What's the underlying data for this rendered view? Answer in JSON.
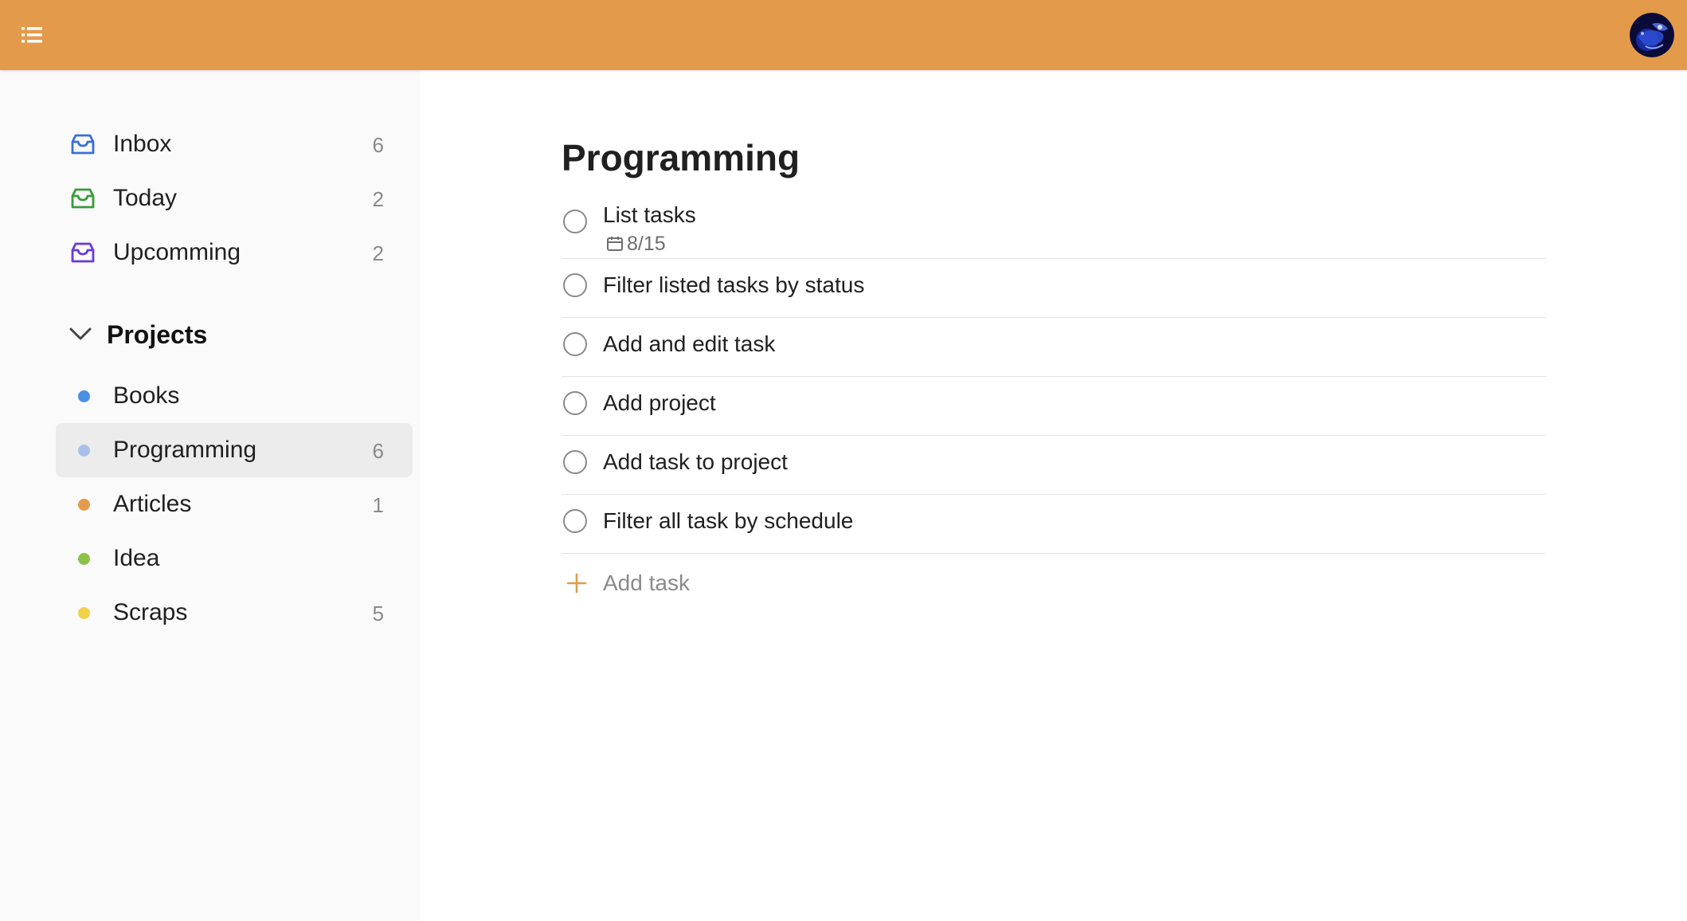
{
  "header": {
    "menu_icon": "list-menu-icon",
    "avatar_icon": "user-avatar",
    "bar_color": "#e39b4b"
  },
  "sidebar": {
    "filters": [
      {
        "label": "Inbox",
        "count": "6",
        "icon": "inbox-icon",
        "color": "#3a6fd8"
      },
      {
        "label": "Today",
        "count": "2",
        "icon": "inbox-icon",
        "color": "#3a9b3a"
      },
      {
        "label": "Upcomming",
        "count": "2",
        "icon": "inbox-icon",
        "color": "#6a3ad8"
      }
    ],
    "projects_title": "Projects",
    "projects": [
      {
        "label": "Books",
        "count": "",
        "color": "#4a90e2"
      },
      {
        "label": "Programming",
        "count": "6",
        "color": "#a8c0e8",
        "active": true
      },
      {
        "label": "Articles",
        "count": "1",
        "color": "#e39b4b"
      },
      {
        "label": "Idea",
        "count": "",
        "color": "#8bc34a"
      },
      {
        "label": "Scraps",
        "count": "5",
        "color": "#f2d04a"
      }
    ]
  },
  "main": {
    "title": "Programming",
    "tasks": [
      {
        "title": "List tasks",
        "date": "8/15"
      },
      {
        "title": "Filter listed tasks by status"
      },
      {
        "title": "Add and edit task"
      },
      {
        "title": "Add project"
      },
      {
        "title": "Add task to project"
      },
      {
        "title": "Filter all task by schedule"
      }
    ],
    "add_task_label": "Add task",
    "accent": "#e39b4b"
  }
}
